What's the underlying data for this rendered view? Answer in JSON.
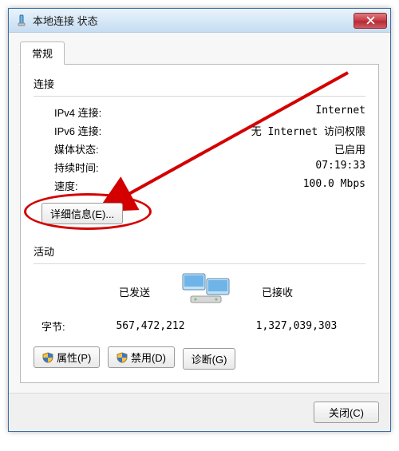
{
  "window": {
    "title": "本地连接 状态"
  },
  "tab": {
    "label": "常规"
  },
  "connection": {
    "section_title": "连接",
    "rows": {
      "ipv4_label": "IPv4 连接:",
      "ipv4_value": "Internet",
      "ipv6_label": "IPv6 连接:",
      "ipv6_value": "无 Internet 访问权限",
      "media_label": "媒体状态:",
      "media_value": "已启用",
      "duration_label": "持续时间:",
      "duration_value": "07:19:33",
      "speed_label": "速度:",
      "speed_value": "100.0 Mbps"
    },
    "details_btn": "详细信息(E)..."
  },
  "activity": {
    "section_title": "活动",
    "sent_label": "已发送",
    "recv_label": "已接收",
    "bytes_label": "字节:",
    "sent_value": "567,472,212",
    "recv_value": "1,327,039,303"
  },
  "buttons": {
    "properties": "属性(P)",
    "disable": "禁用(D)",
    "diagnose": "诊断(G)",
    "close": "关闭(C)"
  }
}
